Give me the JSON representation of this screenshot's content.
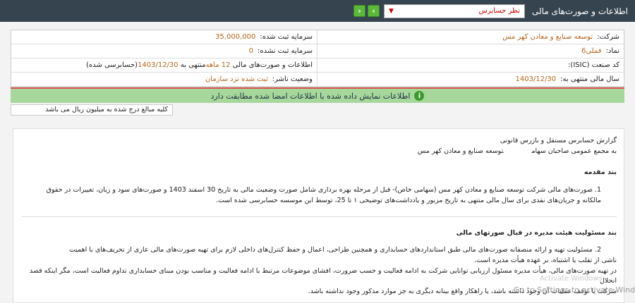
{
  "header": {
    "title": "اطلاعات و صورت‌های مالی",
    "selected_report": "نظر حسابرس",
    "next_label": "‹",
    "prev_label": "›"
  },
  "info": {
    "company_label": "شرکت:",
    "company_value": "توسعه صنایع و معادن کهر مس",
    "registered_capital_label": "سرمایه ثبت شده:",
    "registered_capital_value": "35,000,000",
    "symbol_label": "نماد:",
    "symbol_value": "فملی6",
    "unregistered_capital_label": "سرمایه ثبت نشده:",
    "unregistered_capital_value": "0",
    "isic_label": "کد صنعت (ISIC):",
    "isic_value": "",
    "statements_label": "اطلاعات و صورت‌های مالی",
    "statements_period": "12 ماهه",
    "statements_ending": "منتهی به",
    "statements_date": "1403/12/30",
    "statements_status": "(حسابرسی شده)",
    "fiscal_year_label": "سال مالی منتهی به:",
    "fiscal_year_value": "1403/12/30",
    "publisher_status_label": "وضعیت ناشر:",
    "publisher_status_value": "ثبت شده نزد سازمان"
  },
  "alert": {
    "icon": "info-icon",
    "text": "اطلاعات نمایش داده شده با اطلاعات امضا شده مطابقت دارد"
  },
  "note": "کلیه مبالغ درج شده به میلیون ریال می باشد",
  "report": {
    "title_line1": "گزارش حسابرس مستقل و بازرس قانونی",
    "title_line2": "به مجمع عمومی صاحبان سهام",
    "title_company": "توسعه صنایع و معادن کهر مس",
    "intro_heading": "بند مقدمه",
    "intro_p1": "1. صورت‌های مالی شرکت توسعه صنایع و معادن کهر مس (سهامی خاص)- قبل از مرحله بهره برداری شامل صورت وضعیت مالی به تاریخ 30 اسفند 1403 و صورت‌های سود و زیان، تغییرات در حقوق",
    "intro_p2": "مالکانه و جریان‌های نقدی برای سال مالی منتهی به تاریخ مزبور و یادداشت‌های توضیحی ۱ تا 25، توسط این موسسه حسابرسی شده است.",
    "resp_heading": "بند مسئولیت هیئت مدیره در قبال صورتهای مالی",
    "resp_p1": "2. مسئولیت تهیه و ارائه منصفانه صورت‌های مالی طبق استانداردهای حسابداری و همچنین طراحی، اعمال و حفظ کنترل‌های داخلی لازم برای تهیه صورت‌های مالی عاری از تحریف‌های با اهمیت",
    "resp_p2": "ناشی از تقلب یا اشتباه، بر عهده هیأت مدیره است.",
    "resp_p3": "در تهیه صورت‌های مالی، هیأت مدیره مسئول ارزیابی توانایی شرکت به ادامه فعالیت و حسب ضرورت، افشای موضوعات مرتبط با ادامه فعالیت و مناسب بودن مبنای حسابداری تداوم فعالیت است، مگر اینکه قصد انحلال",
    "resp_p4": "شرکت یا توقف عملیات آن وجود داشته باشد، یا راهکار واقع بینانه دیگری به جز موارد مذکور وجود نداشته باشد."
  },
  "watermark": {
    "line_ghost": "Activate Windows",
    "line_main": "Go to Settings to activate Windows."
  }
}
